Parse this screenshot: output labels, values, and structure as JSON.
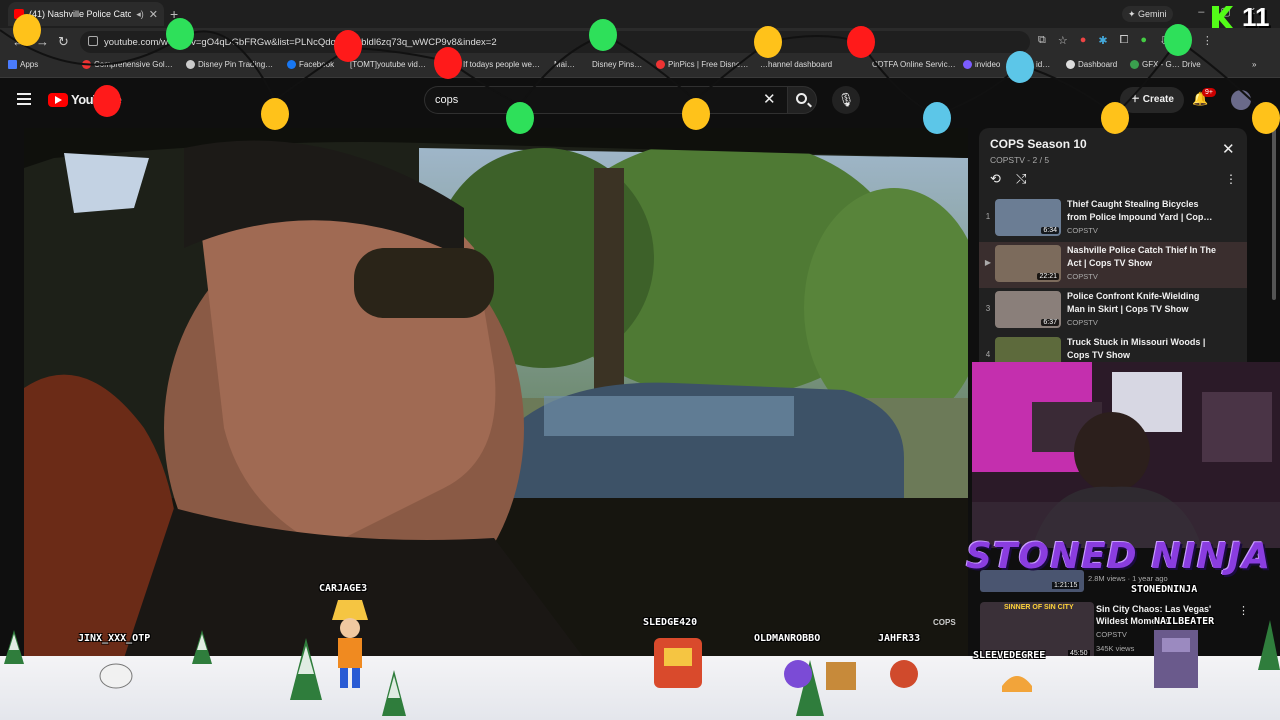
{
  "browser": {
    "tab_title": "(41) Nashville Police Catch",
    "gemini_label": "Gemini",
    "url": "youtube.com/watch?v=gO4qDGbFRGw&list=PLNcQdq6…0pbldl6zq73q_wWCP9v8&index=2",
    "bookmarks": [
      "Apps",
      "Comprehensive Gol…",
      "Disney Pin Trading…",
      "Facebook",
      "[TOMT]youtube vid…",
      "If todays people we…",
      "Mai…",
      "Disney Pins…",
      "PinPics | Free Disne…",
      "…hannel dashboard",
      "CDTFA Online Servic…",
      "invideo",
      "id…",
      "Dashboard",
      "GFX - G… Drive"
    ]
  },
  "youtube": {
    "logo_text": "YouTube",
    "search_query": "cops",
    "create_label": "Create",
    "notif_badge": "9+"
  },
  "playlist": {
    "title": "COPS Season 10",
    "subtitle": "COPSTV - 2 / 5",
    "items": [
      {
        "num": "1",
        "title": "Thief Caught Stealing Bicycles from Police Impound Yard | Cop…",
        "channel": "COPSTV",
        "duration": "6:34",
        "thumb_color": "#6b7d94"
      },
      {
        "num": "▶",
        "title": "Nashville Police Catch Thief In The Act | Cops TV Show",
        "channel": "COPSTV",
        "duration": "22:21",
        "thumb_color": "#7c6b5c"
      },
      {
        "num": "3",
        "title": "Police Confront Knife-Wielding Man in Skirt | Cops TV Show",
        "channel": "COPSTV",
        "duration": "6:37",
        "thumb_color": "#8a7f7a"
      },
      {
        "num": "4",
        "title": "Truck Stuck in Missouri Woods | Cops TV Show",
        "channel": "COPSTV",
        "duration": "",
        "thumb_color": "#5d6a3c"
      }
    ]
  },
  "recommendations": {
    "first_duration": "1:21:15",
    "first_meta": "2.8M views · 1 year ago",
    "second_title": "Sin City Chaos: Las Vegas' Wildest Moments Las…",
    "second_channel": "COPSTV",
    "second_views": "345K views",
    "second_duration": "45:50",
    "second_thumb_text": "SINNER OF SIN CITY"
  },
  "overlay": {
    "stream_title": "STONED NINJA",
    "corner_number": "11",
    "video_watermark": "COPS",
    "chat_names": [
      "JINX_XXX_OTP",
      "CARJAGE3",
      "SLEDGE420",
      "OLDMANROBBO",
      "JAHFR33",
      "STONEDNINJA",
      "NAILBEATER",
      "SLEEVEDEGREE"
    ]
  },
  "colors": {
    "yt_red": "#ff0000",
    "bg": "#0f0f0f",
    "ninja_purple": "#8a3de0"
  }
}
